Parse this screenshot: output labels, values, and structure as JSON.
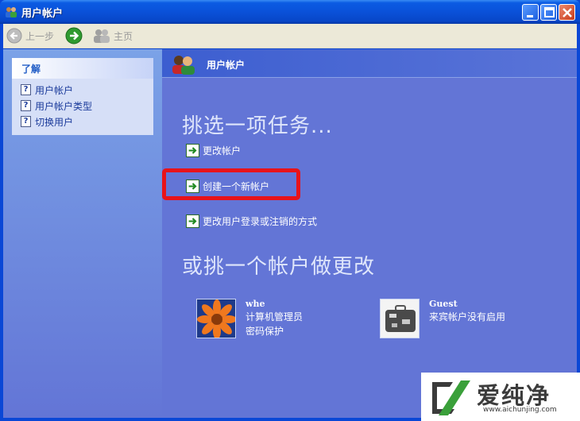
{
  "window": {
    "title": "用户帐户"
  },
  "toolbar": {
    "back_label": "上一步",
    "home_label": "主页"
  },
  "sidebar": {
    "header": "了解",
    "items": [
      {
        "label": "用户帐户",
        "icon": "help-icon"
      },
      {
        "label": "用户帐户类型",
        "icon": "help-icon"
      },
      {
        "label": "切换用户",
        "icon": "help-icon"
      }
    ]
  },
  "main": {
    "header_title": "用户帐户",
    "pick_task": "挑选一项任务...",
    "tasks": [
      {
        "label": "更改帐户",
        "icon": "green-arrow-icon"
      },
      {
        "label": "创建一个新帐户",
        "icon": "green-arrow-icon",
        "highlighted": true
      },
      {
        "label": "更改用户登录或注销的方式",
        "icon": "green-arrow-icon"
      }
    ],
    "or_pick": "或挑一个帐户做更改",
    "accounts": [
      {
        "name": "whe",
        "line1": "计算机管理员",
        "line2": "密码保护",
        "picture": "orange-flower"
      },
      {
        "name": "Guest",
        "line1": "来宾帐户没有启用",
        "line2": "",
        "picture": "suitcase"
      }
    ]
  },
  "watermark": {
    "text": "爱纯净",
    "url": "www.aichunjing.com"
  },
  "colors": {
    "highlight": "#e8131a",
    "task_pane": "#6375d6",
    "sidebar": "#7ba2e7"
  }
}
